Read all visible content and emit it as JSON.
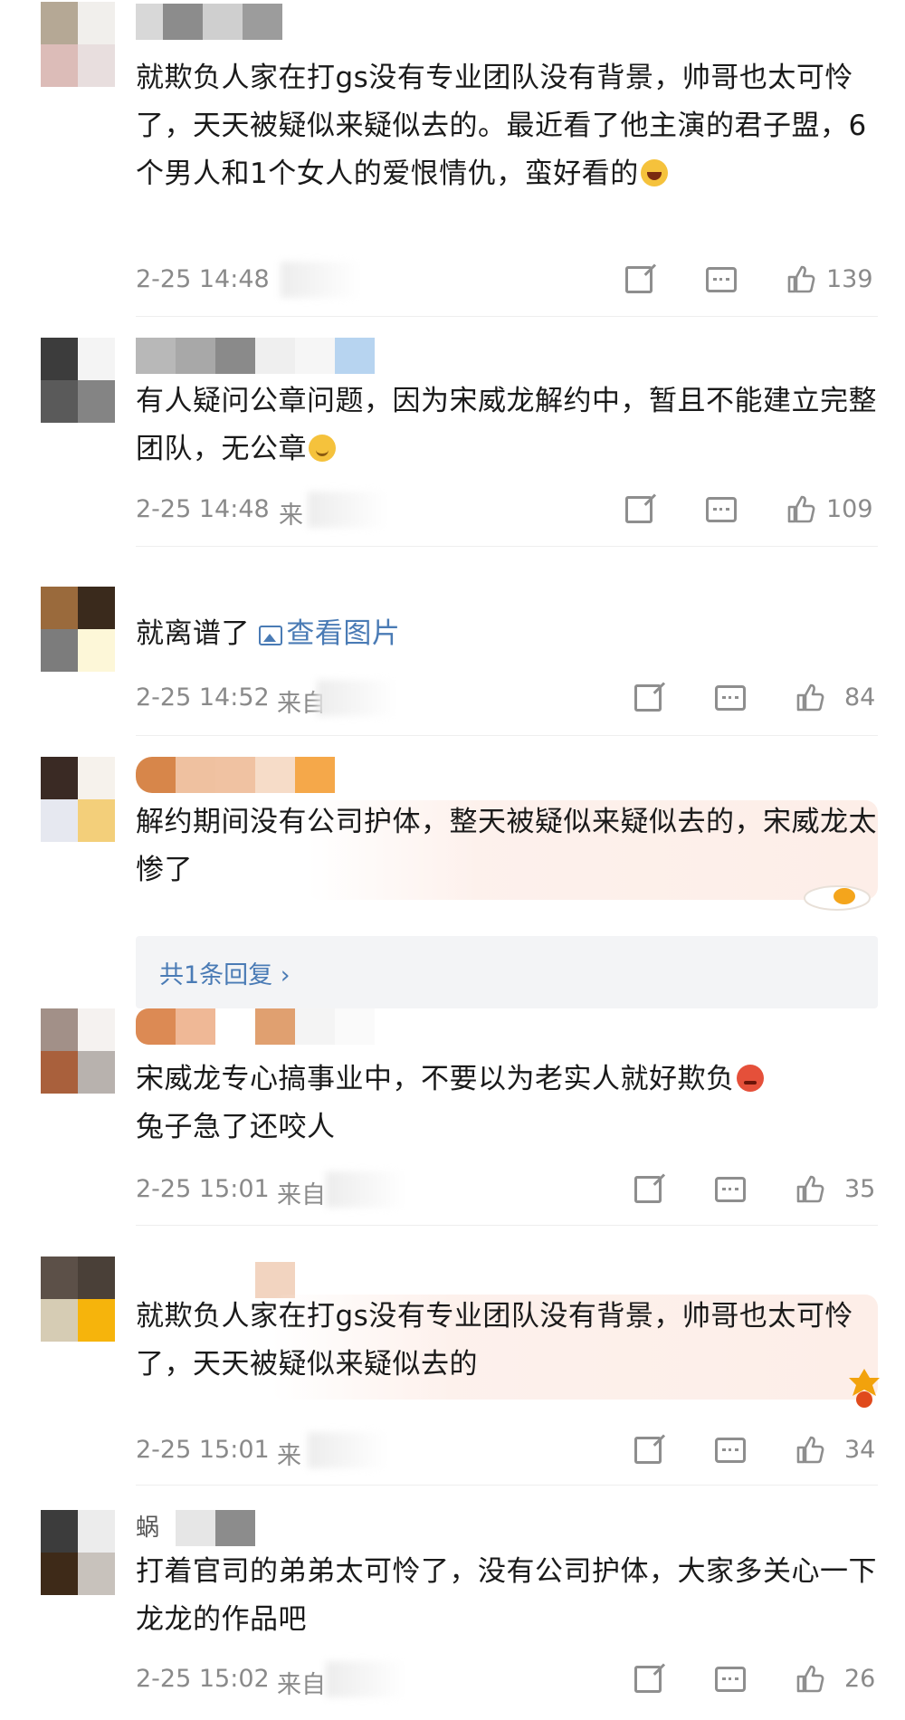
{
  "comments": [
    {
      "text": "就欺负人家在打gs没有专业团队没有背景，帅哥也太可怜了，天天被疑似来疑似去的。最近看了他主演的君子盟，6个男人和1个女人的爱恨情仇，蛮好看的",
      "emoji": "grin-emoji",
      "time": "2-25 14:48",
      "likes": "139"
    },
    {
      "text": "有人疑问公章问题，因为宋威龙解约中，暂且不能建立完整团队，无公章",
      "emoji": "smile-emoji",
      "time": "2-25 14:48",
      "source": "来",
      "likes": "109"
    },
    {
      "text": "就离谱了",
      "link": "查看图片",
      "time": "2-25 14:52",
      "source": "来自",
      "likes": "84"
    },
    {
      "text": "解约期间没有公司护体，整天被疑似来疑似去的，宋威龙太惨了",
      "reply_summary": "共1条回复 ›"
    },
    {
      "text": "宋威龙专心搞事业中，不要以为老实人就好欺负",
      "text2": "兔子急了还咬人",
      "emoji": "angry-emoji",
      "time": "2-25 15:01",
      "source": "来自",
      "likes": "35"
    },
    {
      "text": "就欺负人家在打gs没有专业团队没有背景，帅哥也太可怜了，天天被疑似来疑似去的",
      "time": "2-25 15:01",
      "source": "来",
      "likes": "34"
    },
    {
      "name_fragment": "蜗",
      "text": "打着官司的弟弟太可怜了，没有公司护体，大家多关心一下龙龙的作品吧",
      "time": "2-25 15:02",
      "source": "来自",
      "likes": "26"
    }
  ],
  "icons": {
    "share": "share-icon",
    "comment": "comment-icon",
    "like": "like-icon",
    "image": "image-icon"
  },
  "colors": {
    "link": "#4a7bb5",
    "meta": "#8a8a8a",
    "text": "#1a1a1a",
    "reply_bg": "#f3f4f6"
  }
}
